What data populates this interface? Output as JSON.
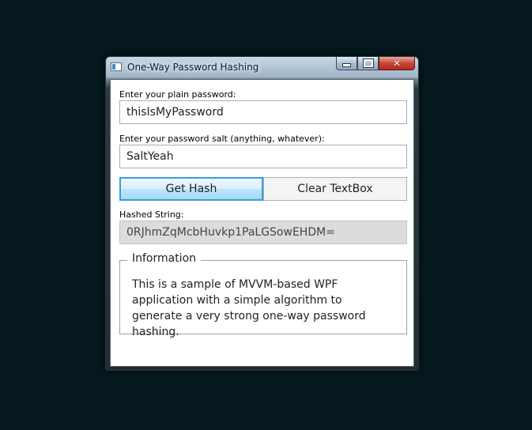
{
  "window": {
    "title": "One-Way Password Hashing",
    "controls": {
      "minimize": "minimize",
      "maximize": "maximize",
      "close": "✕"
    }
  },
  "form": {
    "plain_password_label": "Enter your plain password:",
    "plain_password_value": "thisIsMyPassword",
    "salt_label": "Enter your password salt (anything, whatever):",
    "salt_value": "SaltYeah",
    "get_hash_button": "Get Hash",
    "clear_button": "Clear TextBox",
    "hashed_label": "Hashed String:",
    "hashed_value": "0RJhmZqMcbHuvkp1PaLGSowEHDM="
  },
  "info": {
    "header": "Information",
    "body": "This is a sample of MVVM-based WPF application with a simple algorithm to generate a very strong one-way password hashing."
  },
  "colors": {
    "desktop": "#04181d",
    "focus_border": "#3c9fd0",
    "close_button": "#c8473b"
  },
  "icons": [
    "app-icon",
    "minimize-icon",
    "maximize-icon",
    "close-icon"
  ]
}
